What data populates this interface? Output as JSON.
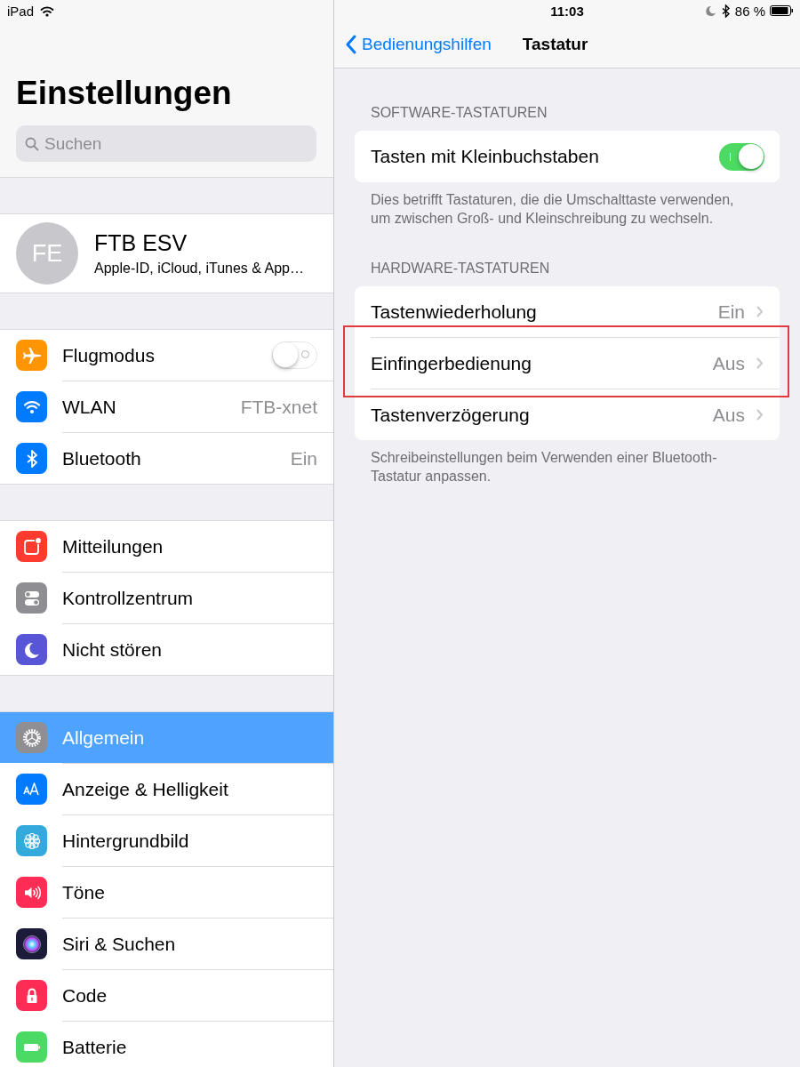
{
  "status_bar": {
    "device": "iPad",
    "time": "11:03",
    "battery": "86 %"
  },
  "sidebar": {
    "title": "Einstellungen",
    "search": {
      "placeholder": "Suchen"
    },
    "profile": {
      "initials": "FE",
      "name": "FTB ESV",
      "subtitle": "Apple-ID, iCloud, iTunes & App…"
    },
    "groups": [
      {
        "items": [
          {
            "label": "Flugmodus",
            "color": "#ff9500",
            "kind": "toggle",
            "on": false,
            "selected": false
          },
          {
            "label": "WLAN",
            "color": "#007aff",
            "kind": "value",
            "value": "FTB-xnet",
            "selected": false
          },
          {
            "label": "Bluetooth",
            "color": "#007aff",
            "kind": "value",
            "value": "Ein",
            "selected": false
          }
        ]
      },
      {
        "items": [
          {
            "label": "Mitteilungen",
            "color": "#ff3b30",
            "kind": "plain",
            "selected": false
          },
          {
            "label": "Kontrollzentrum",
            "color": "#8e8e93",
            "kind": "plain",
            "selected": false
          },
          {
            "label": "Nicht stören",
            "color": "#5856d6",
            "kind": "plain",
            "selected": false
          }
        ]
      },
      {
        "items": [
          {
            "label": "Allgemein",
            "color": "#8e8e93",
            "kind": "plain",
            "selected": true
          },
          {
            "label": "Anzeige & Helligkeit",
            "color": "#007aff",
            "kind": "plain",
            "selected": false
          },
          {
            "label": "Hintergrundbild",
            "color": "#34aadc",
            "kind": "plain",
            "selected": false
          },
          {
            "label": "Töne",
            "color": "#ff2d55",
            "kind": "plain",
            "selected": false
          },
          {
            "label": "Siri & Suchen",
            "color": "#1c1c3a",
            "kind": "plain",
            "selected": false
          },
          {
            "label": "Code",
            "color": "#ff2d55",
            "kind": "plain",
            "selected": false
          },
          {
            "label": "Batterie",
            "color": "#4cd964",
            "kind": "plain",
            "selected": false
          }
        ]
      }
    ]
  },
  "detail": {
    "back": "Bedienungshilfen",
    "title": "Tastatur",
    "sections": [
      {
        "header": "SOFTWARE-TASTATUREN",
        "rows": [
          {
            "label": "Tasten mit Kleinbuchstaben",
            "kind": "toggle",
            "on": true,
            "highlighted": false
          }
        ],
        "footer": "Dies betrifft Tastaturen, die die Umschalttaste verwenden, um zwischen Groß- und Kleinschreibung zu wechseln."
      },
      {
        "header": "HARDWARE-TASTATUREN",
        "rows": [
          {
            "label": "Tastenwiederholung",
            "kind": "disclosure",
            "value": "Ein",
            "highlighted": false
          },
          {
            "label": "Einfingerbedienung",
            "kind": "disclosure",
            "value": "Aus",
            "highlighted": true
          },
          {
            "label": "Tastenverzögerung",
            "kind": "disclosure",
            "value": "Aus",
            "highlighted": false
          }
        ],
        "footer": "Schreibeinstellungen beim Verwenden einer Bluetooth-Tastatur anpassen."
      }
    ]
  }
}
